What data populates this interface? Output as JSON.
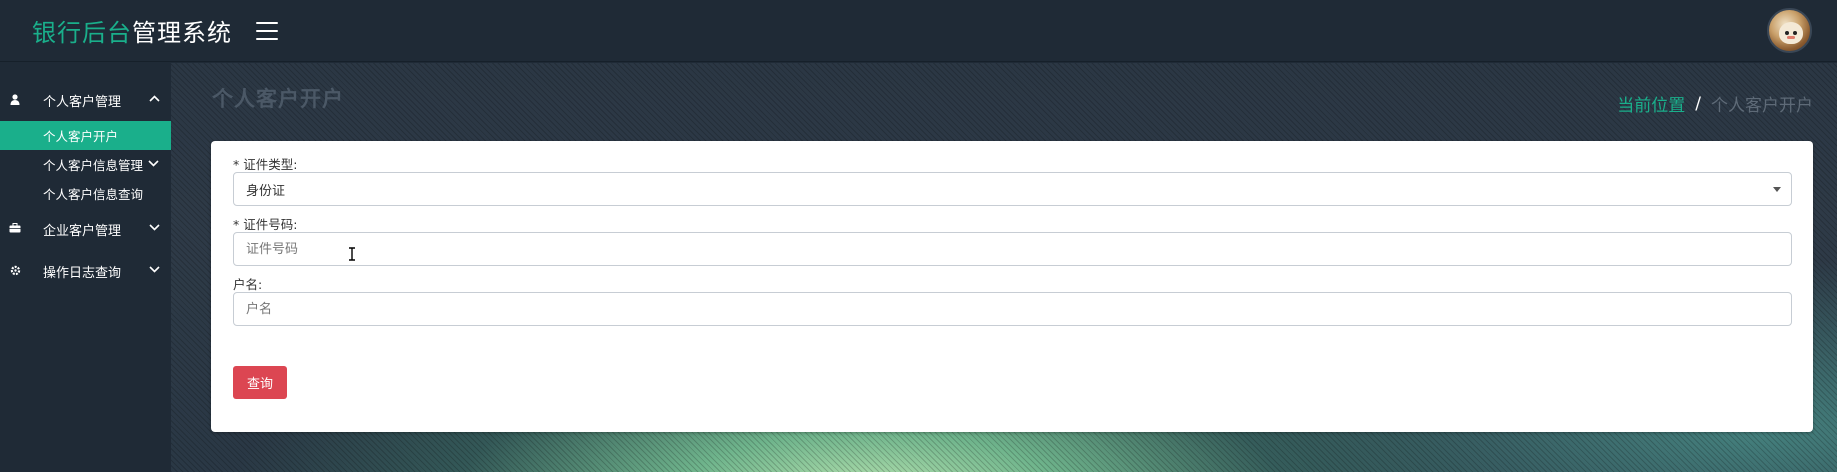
{
  "header": {
    "brand_accent": "银行后台",
    "brand_rest": "管理系统",
    "accent_color": "#1aaf8b"
  },
  "sidebar": {
    "groups": [
      {
        "label": "个人客户管理",
        "icon": "user-icon",
        "expanded": true,
        "items": [
          {
            "label": "个人客户开户",
            "active": true
          },
          {
            "label": "个人客户信息管理",
            "has_submenu": true
          },
          {
            "label": "个人客户信息查询"
          }
        ]
      },
      {
        "label": "企业客户管理",
        "icon": "briefcase-icon",
        "expanded": false
      },
      {
        "label": "操作日志查询",
        "icon": "gear-icon",
        "expanded": false
      }
    ]
  },
  "main": {
    "page_title": "个人客户开户",
    "breadcrumb": {
      "link": "当前位置",
      "separator": "/",
      "current": "个人客户开户"
    },
    "form": {
      "id_type_label": "* 证件类型:",
      "id_type_value": "身份证",
      "id_number_label": "* 证件号码:",
      "id_number_placeholder": "证件号码",
      "name_label": "户名:",
      "name_placeholder": "户名",
      "query_button": "查询",
      "button_color": "#dc4652"
    }
  }
}
